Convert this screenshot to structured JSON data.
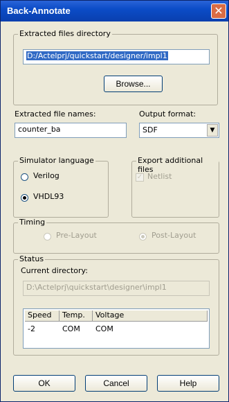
{
  "window": {
    "title": "Back-Annotate",
    "close_glyph": "✕"
  },
  "extracted_dir": {
    "legend": "Extracted files directory",
    "value": "D:/Actelprj/quickstart/designer/impl1",
    "browse_label": "Browse..."
  },
  "file_names": {
    "label": "Extracted file names:",
    "value": "counter_ba"
  },
  "output_format": {
    "label": "Output format:",
    "value": "SDF",
    "arrow": "▼"
  },
  "simulator": {
    "legend": "Simulator language",
    "options": [
      {
        "label": "Verilog",
        "selected": false
      },
      {
        "label": "VHDL93",
        "selected": true
      }
    ]
  },
  "export": {
    "legend": "Export additional files",
    "netlist_label": "Netlist",
    "checked": true,
    "check_glyph": "✓"
  },
  "timing": {
    "legend": "Timing",
    "options": [
      {
        "label": "Pre-Layout",
        "selected": false
      },
      {
        "label": "Post-Layout",
        "selected": true
      }
    ]
  },
  "status": {
    "legend": "Status",
    "current_dir_label": "Current directory:",
    "current_dir_value": "D:\\Actelprj\\quickstart\\designer\\impl1",
    "columns": [
      "Speed",
      "Temp.",
      "Voltage"
    ],
    "rows": [
      [
        "-2",
        "COM",
        "COM"
      ]
    ]
  },
  "buttons": {
    "ok": "OK",
    "cancel": "Cancel",
    "help": "Help"
  }
}
